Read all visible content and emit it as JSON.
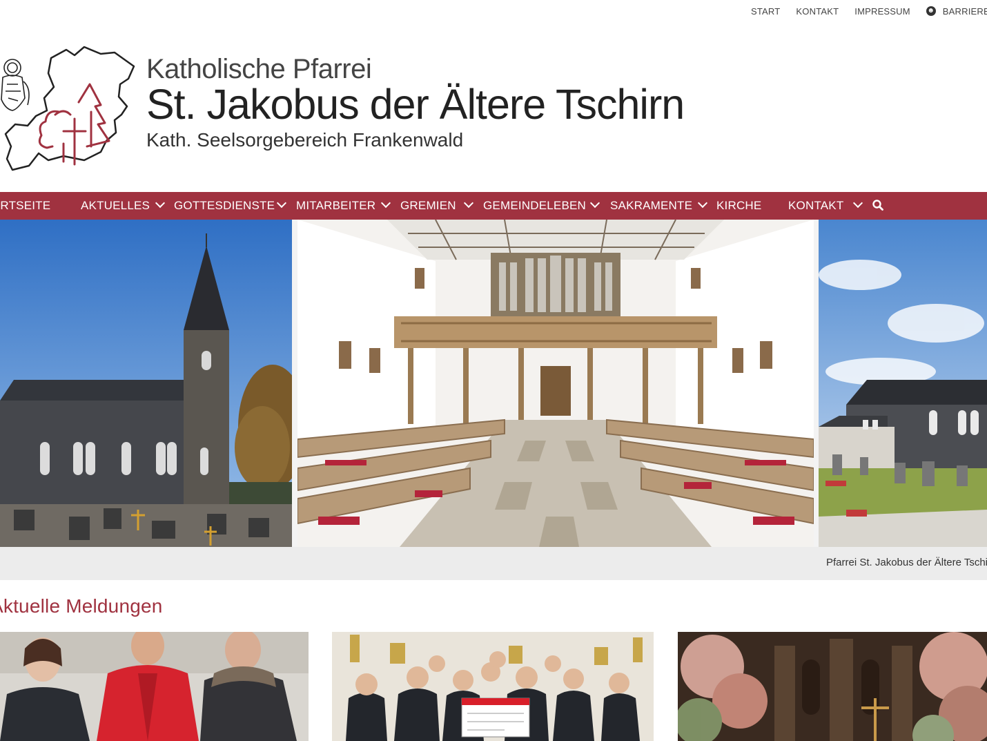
{
  "top_nav": {
    "items": [
      "START",
      "KONTAKT",
      "IMPRESSUM",
      "BARRIEREFREIHEIT"
    ]
  },
  "header": {
    "line1": "Katholische Pfarrei",
    "line2": "St. Jakobus der Ältere Tschirn",
    "line3": "Kath. Seelsorgebereich Frankenwald"
  },
  "main_nav": {
    "items": [
      {
        "label": "STARTSEITE",
        "has_dropdown": false
      },
      {
        "label": "AKTUELLES",
        "has_dropdown": true
      },
      {
        "label": "GOTTESDIENSTE",
        "has_dropdown": true
      },
      {
        "label": "MITARBEITER",
        "has_dropdown": true
      },
      {
        "label": "GREMIEN",
        "has_dropdown": true
      },
      {
        "label": "GEMEINDELEBEN",
        "has_dropdown": true
      },
      {
        "label": "SAKRAMENTE",
        "has_dropdown": true
      },
      {
        "label": "KIRCHE",
        "has_dropdown": false
      },
      {
        "label": "KONTAKT",
        "has_dropdown": true
      }
    ],
    "search_icon": "search-icon"
  },
  "hero": {
    "caption": "Pfarrei St. Jakobus der Ältere Tschirn"
  },
  "news": {
    "title": "Aktuelle Meldungen"
  },
  "colors": {
    "accent": "#a03240",
    "caption_bar": "#ececec"
  }
}
